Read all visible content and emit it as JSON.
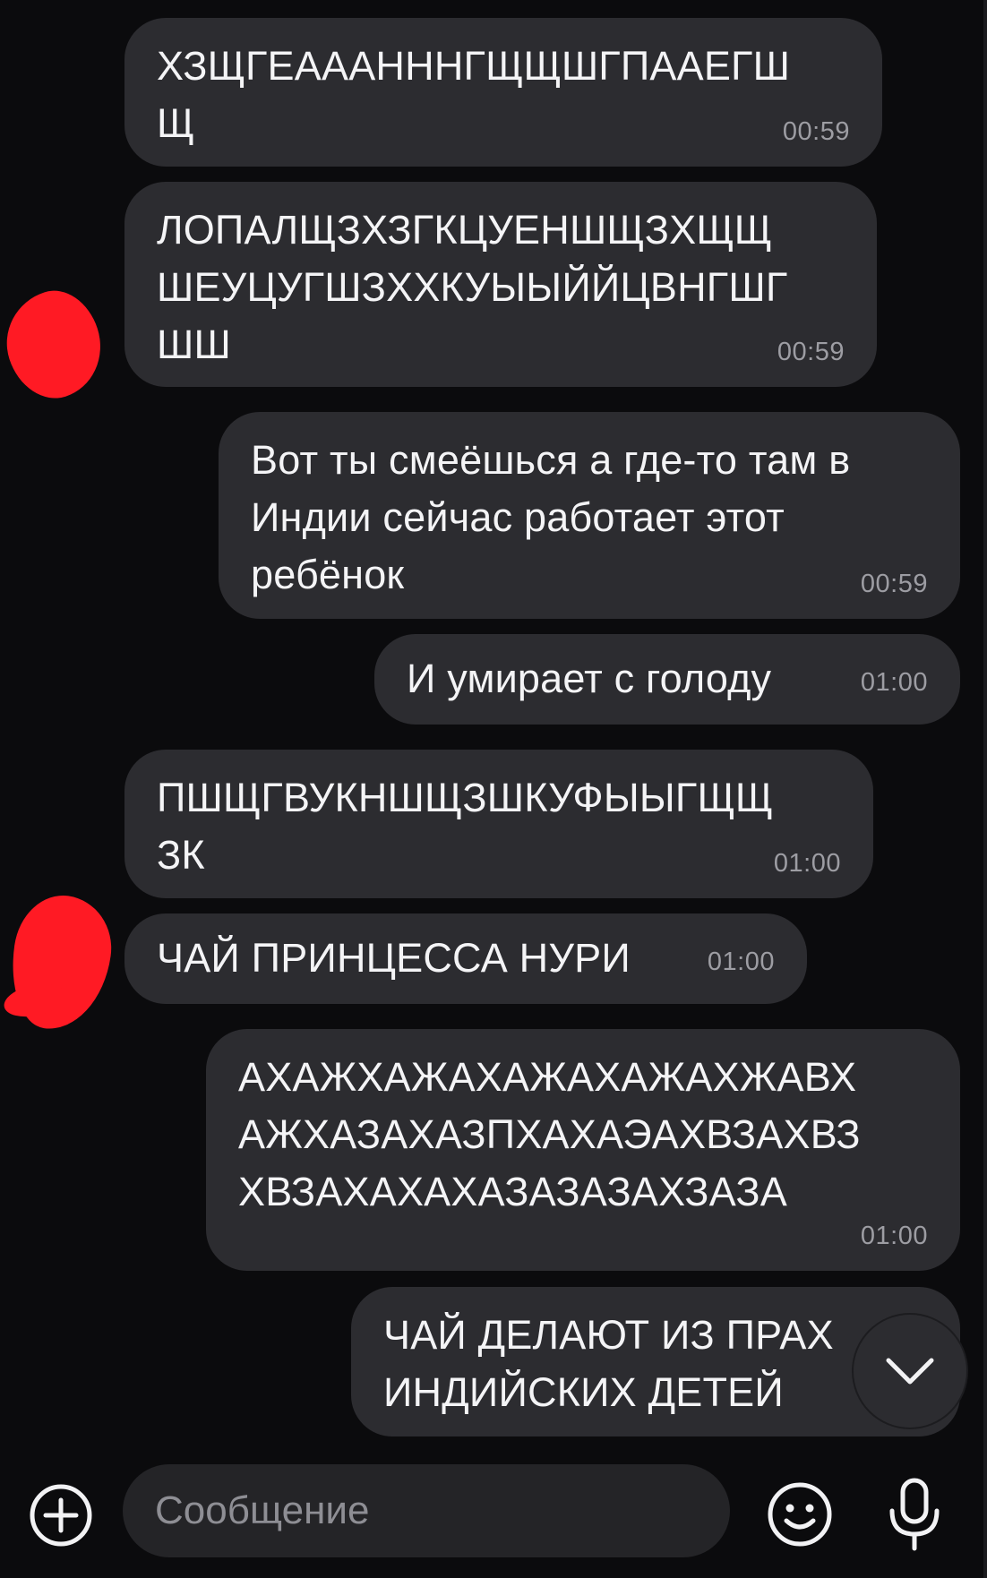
{
  "messages": [
    {
      "text": "ХЗЩГЕАААННHГЩЩШГПААЕГШ\nЩ",
      "time": "00:59",
      "side": "incoming"
    },
    {
      "text": "ЛОПАЛЩЗХЗГКЦУЕНШЩЗХЩЩ\nШЕУЦУГШЗХХКУЫЫЙЙЦВНГШГ\nШШ",
      "time": "00:59",
      "side": "incoming"
    },
    {
      "text": "Вот ты смеёшься а где-то там в\nИндии сейчас работает этот\nребёнок",
      "time": "00:59",
      "side": "outgoing"
    },
    {
      "text": "И умирает с голоду",
      "time": "01:00",
      "side": "outgoing"
    },
    {
      "text": "ПШЩГВУКНШЩЗШКУФЫЫГЩЩ\nЗК",
      "time": "01:00",
      "side": "incoming"
    },
    {
      "text": "ЧАЙ ПРИНЦЕССА НУРИ",
      "time": "01:00",
      "side": "incoming"
    },
    {
      "text": "АХАЖХАЖАХАЖАХАЖАХЖАВХ\nАЖХАЗАХАЗПХАХАЭАХВЗАХВЗ\nХВЗАХАХАХАЗАЗАЗАХЗАЗА",
      "time": "01:00",
      "side": "outgoing"
    },
    {
      "text": "ЧАЙ ДЕЛАЮТ ИЗ ПРАХ\nИНДИЙСКИХ ДЕТЕЙ",
      "time": "",
      "side": "outgoing"
    }
  ],
  "composer": {
    "placeholder": "Сообщение"
  },
  "icons": {
    "attach": "plus-circle-icon",
    "emoji": "smiley-icon",
    "mic": "microphone-icon",
    "scroll": "chevron-down-icon"
  },
  "colors": {
    "background": "#0b0b0d",
    "bubble": "#2c2c30",
    "text": "#f4f4f6",
    "time": "#9d9da3",
    "redaction": "#ff1a24"
  }
}
